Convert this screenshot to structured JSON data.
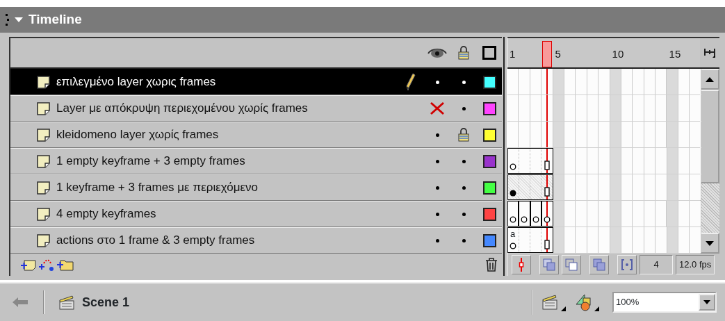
{
  "panel": {
    "title": "Timeline",
    "expanded": true
  },
  "layers": [
    {
      "name": "επιλεγμένο layer χωρις frames",
      "selected": true,
      "editing": true,
      "hidden": false,
      "locked": false,
      "color": "#44ffff"
    },
    {
      "name": "Layer με απόκρυψη περιεχομένου χωρίς frames",
      "selected": false,
      "editing": false,
      "hidden": true,
      "locked": false,
      "color": "#ff44ff"
    },
    {
      "name": "kleidomeno layer χωρίς frames",
      "selected": false,
      "editing": false,
      "hidden": false,
      "locked": true,
      "color": "#ffff33"
    },
    {
      "name": "1 empty keyframe + 3 empty frames",
      "selected": false,
      "editing": false,
      "hidden": false,
      "locked": false,
      "color": "#9933cc",
      "frames": [
        {
          "kind": "empty_keyframe"
        },
        {
          "kind": "empty"
        },
        {
          "kind": "empty"
        },
        {
          "kind": "end"
        }
      ]
    },
    {
      "name": "1 keyframe + 3 frames με περιεχόμενο",
      "selected": false,
      "editing": false,
      "hidden": false,
      "locked": false,
      "color": "#44ff44",
      "frames": [
        {
          "kind": "keyframe"
        },
        {
          "kind": "filled"
        },
        {
          "kind": "filled"
        },
        {
          "kind": "end"
        }
      ]
    },
    {
      "name": "4 empty keyframes",
      "selected": false,
      "editing": false,
      "hidden": false,
      "locked": false,
      "color": "#ff4444",
      "frames": [
        {
          "kind": "empty_keyframe"
        },
        {
          "kind": "empty_keyframe"
        },
        {
          "kind": "empty_keyframe"
        },
        {
          "kind": "empty_keyframe"
        }
      ]
    },
    {
      "name": "actions στο 1 frame & 3 empty frames",
      "selected": false,
      "editing": false,
      "hidden": false,
      "locked": false,
      "color": "#4488ff",
      "frames": [
        {
          "kind": "action_keyframe",
          "label": "a"
        },
        {
          "kind": "empty"
        },
        {
          "kind": "empty"
        },
        {
          "kind": "end"
        }
      ]
    }
  ],
  "timeline": {
    "ruler": [
      "1",
      "5",
      "10",
      "15"
    ],
    "current_frame": "4",
    "frame_rate": "12.0 fps"
  },
  "scene": {
    "name": "Scene 1"
  },
  "zoom": {
    "value": "100%"
  }
}
